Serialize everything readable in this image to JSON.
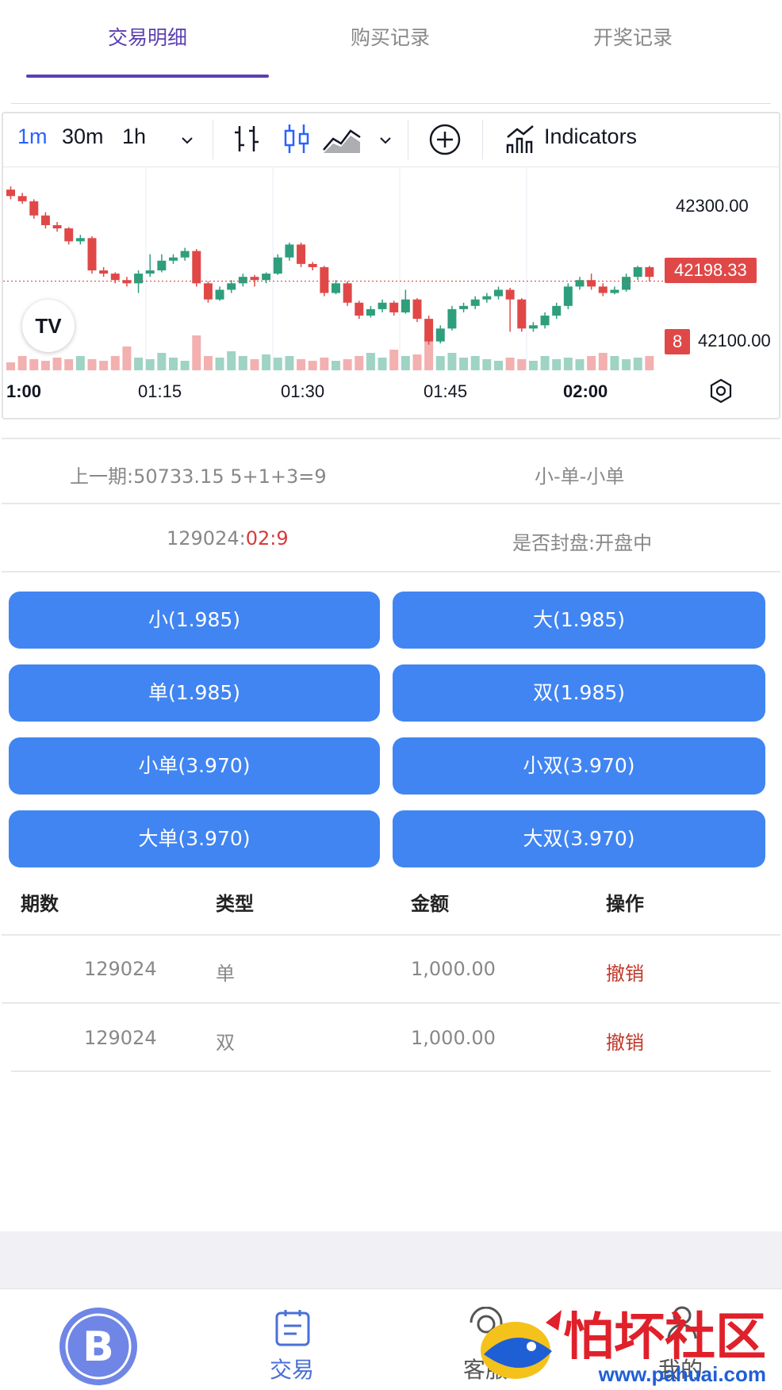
{
  "tabs": [
    {
      "label": "交易明细",
      "active": true
    },
    {
      "label": "购买记录",
      "active": false
    },
    {
      "label": "开奖记录",
      "active": false
    }
  ],
  "chart_toolbar": {
    "intervals": [
      "1m",
      "30m",
      "1h"
    ],
    "selected_interval": "1m",
    "indicators_label": "Indicators"
  },
  "chart_data": {
    "type": "candlestick",
    "price_levels": [
      "42300.00",
      "42100.00"
    ],
    "current_price": "42198.33",
    "volume_badge": "8",
    "time_labels": [
      "1:00",
      "01:15",
      "01:30",
      "01:45",
      "02:00"
    ],
    "up_color": "#2e9e7c",
    "down_color": "#e04848",
    "candles": [
      [
        42340,
        42330,
        42345,
        42325
      ],
      [
        42330,
        42322,
        42335,
        42318
      ],
      [
        42322,
        42300,
        42325,
        42295
      ],
      [
        42300,
        42285,
        42305,
        42280
      ],
      [
        42285,
        42280,
        42290,
        42275
      ],
      [
        42280,
        42260,
        42282,
        42255
      ],
      [
        42260,
        42265,
        42270,
        42255
      ],
      [
        42265,
        42215,
        42268,
        42210
      ],
      [
        42215,
        42210,
        42220,
        42205
      ],
      [
        42210,
        42200,
        42212,
        42195
      ],
      [
        42200,
        42195,
        42205,
        42190
      ],
      [
        42195,
        42210,
        42215,
        42180
      ],
      [
        42210,
        42215,
        42240,
        42205
      ],
      [
        42215,
        42230,
        42240,
        42212
      ],
      [
        42230,
        42235,
        42240,
        42225
      ],
      [
        42235,
        42245,
        42250,
        42230
      ],
      [
        42245,
        42195,
        42248,
        42190
      ],
      [
        42195,
        42170,
        42198,
        42165
      ],
      [
        42170,
        42185,
        42190,
        42168
      ],
      [
        42185,
        42195,
        42200,
        42180
      ],
      [
        42195,
        42205,
        42210,
        42190
      ],
      [
        42205,
        42200,
        42208,
        42190
      ],
      [
        42200,
        42210,
        42212,
        42195
      ],
      [
        42210,
        42235,
        42240,
        42208
      ],
      [
        42235,
        42255,
        42258,
        42230
      ],
      [
        42255,
        42225,
        42258,
        42220
      ],
      [
        42225,
        42220,
        42228,
        42215
      ],
      [
        42220,
        42180,
        42222,
        42175
      ],
      [
        42180,
        42195,
        42200,
        42178
      ],
      [
        42195,
        42165,
        42198,
        42160
      ],
      [
        42165,
        42145,
        42168,
        42140
      ],
      [
        42145,
        42155,
        42160,
        42142
      ],
      [
        42155,
        42165,
        42170,
        42150
      ],
      [
        42165,
        42150,
        42168,
        42145
      ],
      [
        42150,
        42170,
        42185,
        42148
      ],
      [
        42170,
        42140,
        42172,
        42135
      ],
      [
        42140,
        42105,
        42145,
        42100
      ],
      [
        42105,
        42125,
        42130,
        42102
      ],
      [
        42125,
        42155,
        42160,
        42122
      ],
      [
        42155,
        42160,
        42165,
        42150
      ],
      [
        42160,
        42170,
        42175,
        42155
      ],
      [
        42170,
        42175,
        42180,
        42165
      ],
      [
        42175,
        42185,
        42190,
        42170
      ],
      [
        42185,
        42170,
        42188,
        42120
      ],
      [
        42170,
        42125,
        42172,
        42120
      ],
      [
        42125,
        42130,
        42135,
        42120
      ],
      [
        42130,
        42145,
        42150,
        42125
      ],
      [
        42145,
        42160,
        42165,
        42140
      ],
      [
        42160,
        42190,
        42195,
        42155
      ],
      [
        42190,
        42200,
        42205,
        42185
      ],
      [
        42200,
        42190,
        42210,
        42185
      ],
      [
        42190,
        42180,
        42195,
        42175
      ],
      [
        42180,
        42185,
        42190,
        42178
      ],
      [
        42185,
        42205,
        42210,
        42182
      ],
      [
        42205,
        42220,
        42222,
        42200
      ],
      [
        42220,
        42205,
        42222,
        42198
      ]
    ],
    "volumes": [
      10,
      18,
      14,
      12,
      16,
      14,
      18,
      14,
      12,
      18,
      30,
      16,
      14,
      22,
      16,
      12,
      44,
      18,
      16,
      24,
      18,
      14,
      20,
      16,
      18,
      14,
      12,
      16,
      12,
      14,
      18,
      22,
      16,
      26,
      18,
      20,
      44,
      18,
      22,
      16,
      18,
      14,
      12,
      16,
      14,
      12,
      18,
      14,
      16,
      14,
      18,
      22,
      18,
      14,
      16,
      18
    ]
  },
  "previous_draw": {
    "text": "上一期:50733.15 5+1+3=9",
    "result": "小-单-小单"
  },
  "current_period": {
    "number": "129024:",
    "countdown": "02:9",
    "status": "是否封盘:开盘中"
  },
  "bets": [
    {
      "label": "小(1.985)"
    },
    {
      "label": "大(1.985)"
    },
    {
      "label": "单(1.985)"
    },
    {
      "label": "双(1.985)"
    },
    {
      "label": "小单(3.970)"
    },
    {
      "label": "小双(3.970)"
    },
    {
      "label": "大单(3.970)"
    },
    {
      "label": "大双(3.970)"
    }
  ],
  "orders": {
    "headers": [
      "期数",
      "类型",
      "金额",
      "操作"
    ],
    "rows": [
      {
        "period": "129024",
        "type": "单",
        "amount": "1,000.00",
        "action": "撤销"
      },
      {
        "period": "129024",
        "type": "双",
        "amount": "1,000.00",
        "action": "撤销"
      }
    ]
  },
  "nav": {
    "trade_label": "交易",
    "service_label": "客服",
    "mine_label": "我的"
  },
  "watermark": {
    "text": "怕坏社区",
    "url": "www.pahuai.com"
  },
  "colors": {
    "accent": "#5b3fb0",
    "button": "#4185f2",
    "danger": "#d73a3a"
  }
}
